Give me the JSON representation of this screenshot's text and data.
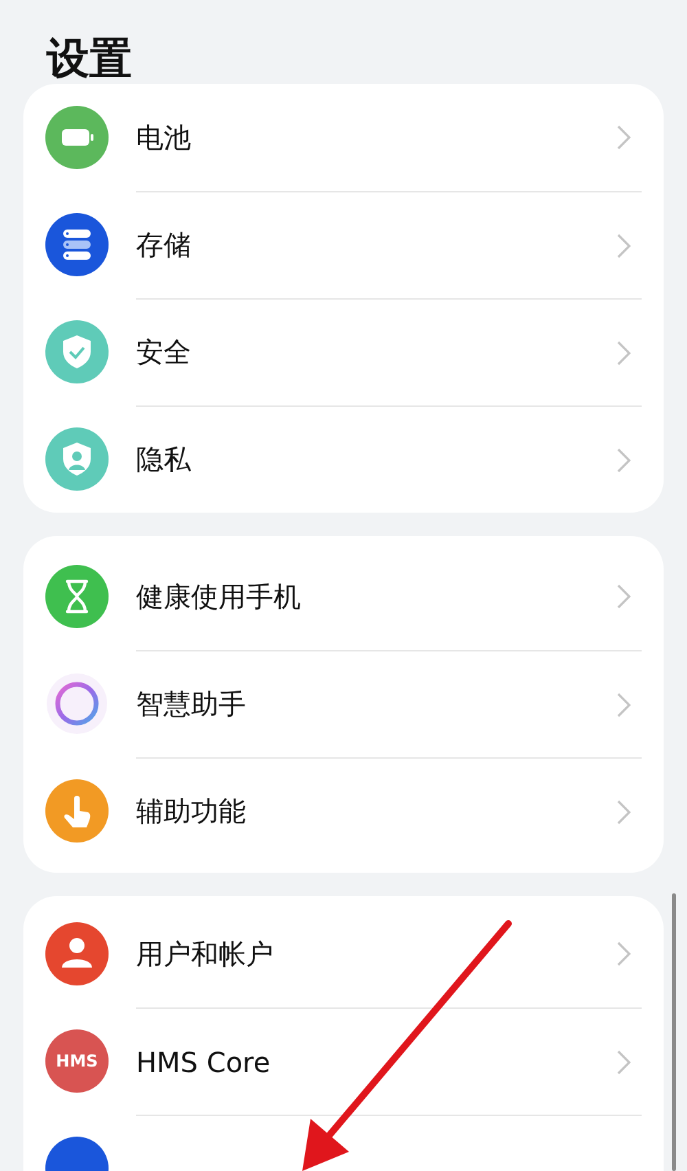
{
  "title": "设置",
  "groups": [
    {
      "items": [
        {
          "kind": "battery",
          "label": "电池"
        },
        {
          "kind": "storage",
          "label": "存储"
        },
        {
          "kind": "security",
          "label": "安全"
        },
        {
          "kind": "privacy",
          "label": "隐私"
        }
      ]
    },
    {
      "items": [
        {
          "kind": "hourglass",
          "label": "健康使用手机"
        },
        {
          "kind": "assistant",
          "label": "智慧助手"
        },
        {
          "kind": "hand",
          "label": "辅助功能"
        }
      ]
    },
    {
      "items": [
        {
          "kind": "user",
          "label": "用户和帐户"
        },
        {
          "kind": "hms",
          "icon_text": "HMS",
          "label": "HMS Core"
        },
        {
          "kind": "partial"
        }
      ]
    }
  ]
}
